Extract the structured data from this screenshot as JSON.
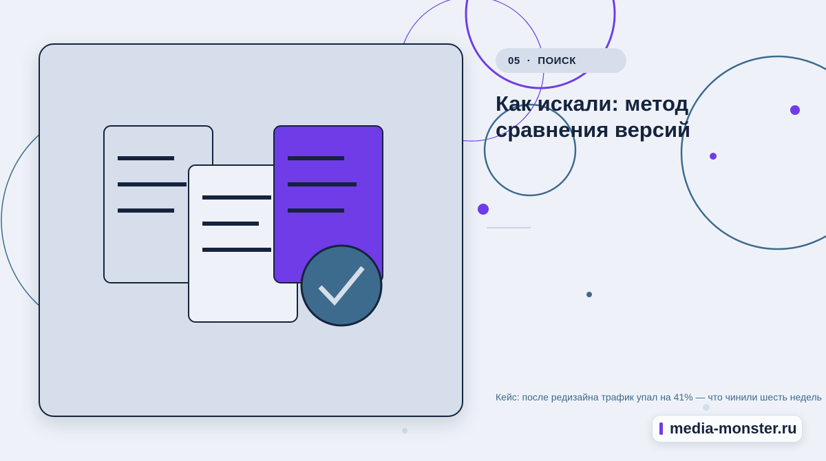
{
  "label": {
    "number": "05",
    "separator": "·",
    "section": "ПОИСК"
  },
  "headline": {
    "line1": "Как искали: метод",
    "line2": "сравнения версий"
  },
  "caption": "Кейс: после редизайна трафик упал на 41% — что чинили шесть недель",
  "brand": {
    "name": "media-monster.ru"
  },
  "illustration": {
    "icons": [
      "document-icon",
      "document-icon",
      "document-icon",
      "checkmark-icon"
    ]
  },
  "colors": {
    "background": "#eef2f8",
    "card": "#d5deea",
    "navy": "#15233d",
    "accent_purple": "#6f3ce8",
    "accent_teal": "#3d6b8e"
  }
}
